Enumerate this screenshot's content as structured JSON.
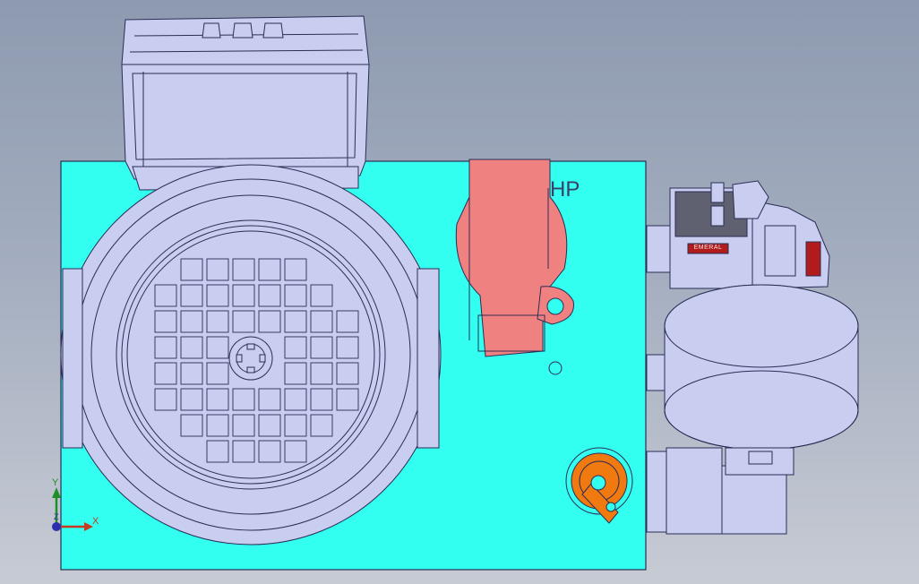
{
  "viewport": {
    "background_top": "#8e9ab0",
    "background_bottom": "#c7cbd4"
  },
  "model": {
    "plate_label": "HP",
    "valve_brand": "EMERAL"
  },
  "triad": {
    "x_label": "X",
    "y_label": "Y",
    "z_label": "Z"
  },
  "colors": {
    "manifold_plate": "#33fff0",
    "motor_body": "#c9cdf0",
    "outline": "#2b2d55",
    "relief_valve": "#f08181",
    "pressure_cap": "#f07a10",
    "brand_badge": "#b11b1b"
  }
}
